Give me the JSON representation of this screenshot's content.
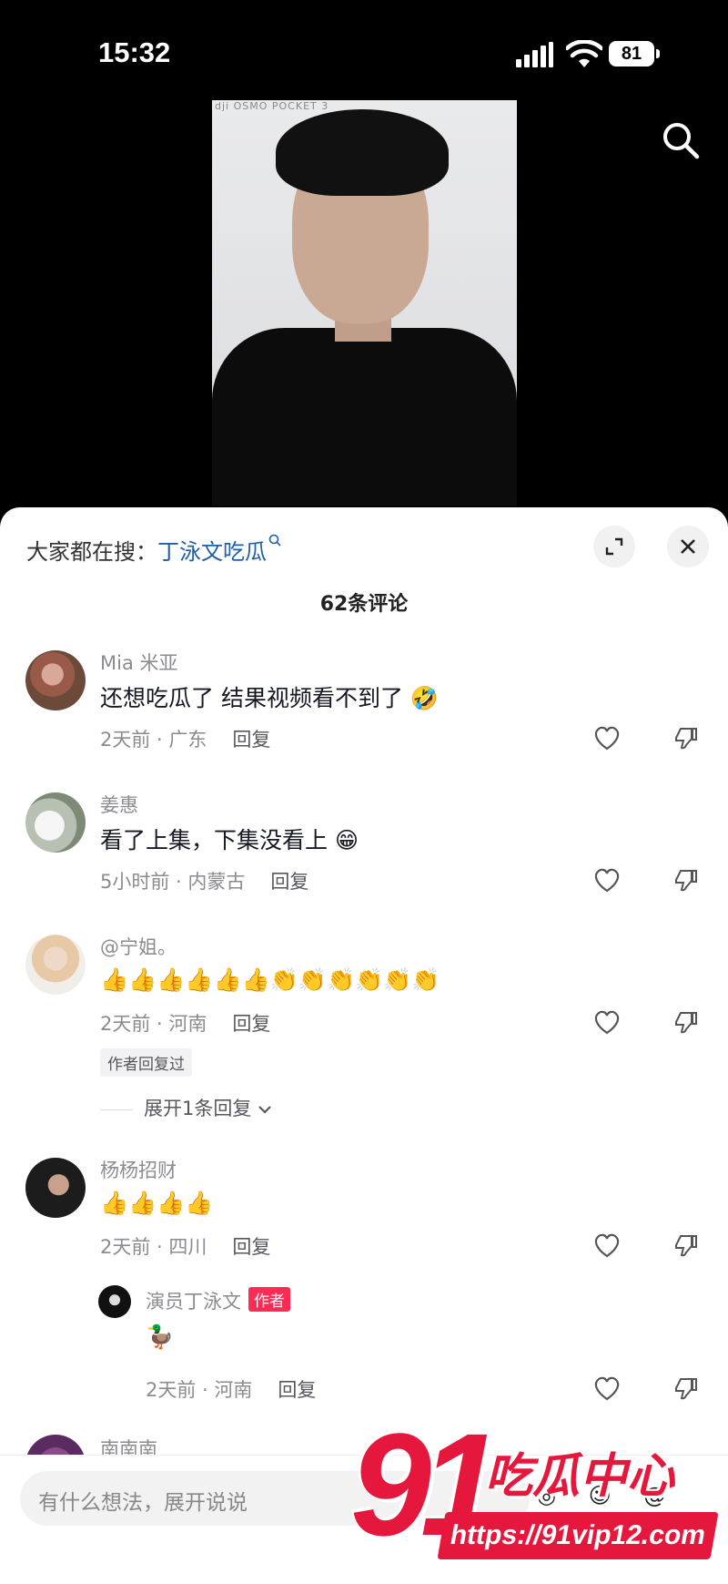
{
  "status_bar": {
    "time": "15:32",
    "battery": "81"
  },
  "video": {
    "watermark": "dji OSMO POCKET 3"
  },
  "sheet": {
    "trending_prefix": "大家都在搜：",
    "trending_keyword": "丁泳文吃瓜",
    "comment_count": "62条评论"
  },
  "comments": [
    {
      "user": "Mia 米亚",
      "text": "还想吃瓜了 结果视频看不到了 🤣",
      "meta": "2天前 · 广东",
      "reply": "回复"
    },
    {
      "user": "姜惠",
      "text": "看了上集，下集没看上 😁",
      "meta": "5小时前 · 内蒙古",
      "reply": "回复"
    },
    {
      "user": "@宁姐。",
      "text": "👍👍👍👍👍👍👏👏👏👏👏👏",
      "meta": "2天前 · 河南",
      "reply": "回复",
      "author_replied": "作者回复过",
      "expand": "展开1条回复"
    },
    {
      "user": "杨杨招财",
      "text": "👍👍👍👍",
      "meta": "2天前 · 四川",
      "reply": "回复"
    }
  ],
  "sub_reply": {
    "user": "演员丁泳文",
    "badge": "作者",
    "text": "🦆",
    "meta": "2天前 · 河南",
    "reply": "回复"
  },
  "next_user": "南南南",
  "input": {
    "placeholder": "有什么想法，展开说说"
  },
  "watermark_logo": {
    "number": "91",
    "text": "吃瓜中心",
    "url": "https://91vip12.com"
  },
  "colors": {
    "accent": "#fe2c55",
    "link": "#1f5fa7",
    "logo": "#e6173c"
  }
}
